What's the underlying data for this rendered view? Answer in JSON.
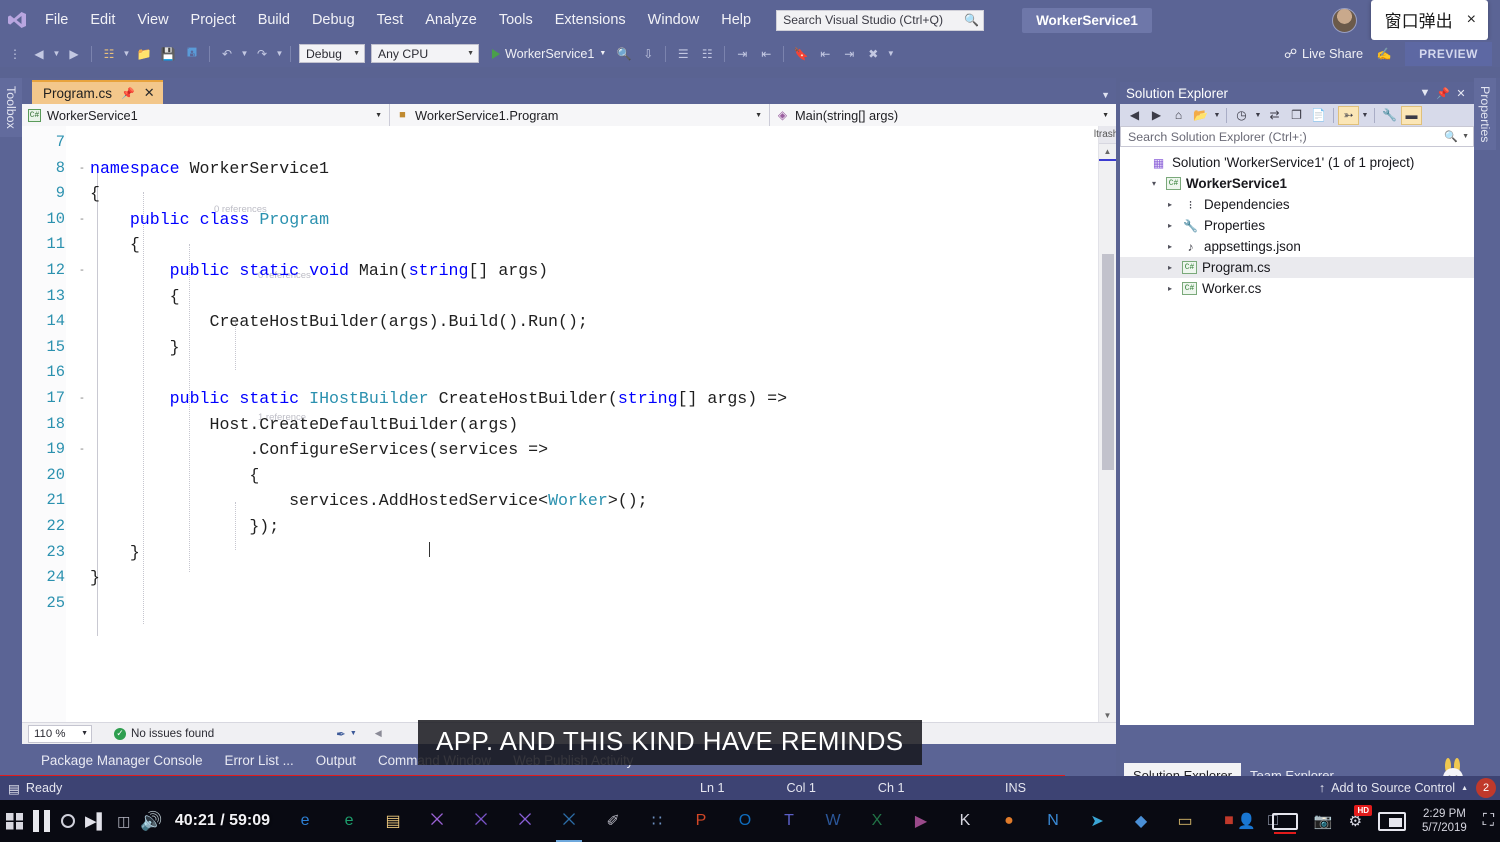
{
  "titlebar": {
    "logo_icon": "visual-studio-logo-icon",
    "menu": [
      "File",
      "Edit",
      "View",
      "Project",
      "Build",
      "Debug",
      "Test",
      "Analyze",
      "Tools",
      "Extensions",
      "Window",
      "Help"
    ],
    "search_placeholder": "Search Visual Studio (Ctrl+Q)",
    "search_icon": "search-icon",
    "solution_name": "WorkerService1",
    "avatar_icon": "user-avatar",
    "popup": {
      "text": "窗口弹出",
      "close": "×"
    }
  },
  "toolbar": {
    "config": "Debug",
    "platform": "Any CPU",
    "run_target": "WorkerService1",
    "live_share": "Live Share",
    "preview_badge": "PREVIEW",
    "icons": [
      "navigate-back-icon",
      "navigate-forward-icon",
      "new-project-icon",
      "open-file-icon",
      "save-icon",
      "save-all-icon",
      "undo-icon",
      "redo-icon",
      "attach-icon",
      "step-icon",
      "comment-icon",
      "uncomment-icon",
      "indent-icon",
      "outdent-icon",
      "bookmark-icon"
    ]
  },
  "docks": {
    "left_tab": "Toolbox",
    "right_tab": "Properties"
  },
  "editor": {
    "tab": {
      "label": "Program.cs",
      "pin_icon": "pin-icon",
      "close_icon": "close-icon"
    },
    "nav": {
      "project": "WorkerService1",
      "type": "WorkerService1.Program",
      "member": "Main(string[] args)"
    },
    "reference_hints": [
      "0 references",
      "0 references",
      "1 reference"
    ],
    "lines": [
      {
        "n": "7",
        "fold": "",
        "text": ""
      },
      {
        "n": "8",
        "fold": "-",
        "text": "namespace WorkerService1",
        "indent": 0
      },
      {
        "n": "9",
        "fold": "",
        "text": "{",
        "indent": 0
      },
      {
        "n": "10",
        "fold": "-",
        "text": "    public class Program",
        "indent": 1
      },
      {
        "n": "11",
        "fold": "",
        "text": "    {",
        "indent": 1
      },
      {
        "n": "12",
        "fold": "-",
        "text": "        public static void Main(string[] args)",
        "indent": 2
      },
      {
        "n": "13",
        "fold": "",
        "text": "        {",
        "indent": 2
      },
      {
        "n": "14",
        "fold": "",
        "text": "            CreateHostBuilder(args).Build().Run();",
        "indent": 3
      },
      {
        "n": "15",
        "fold": "",
        "text": "        }",
        "indent": 2
      },
      {
        "n": "16",
        "fold": "",
        "text": "",
        "indent": 2
      },
      {
        "n": "17",
        "fold": "-",
        "text": "        public static IHostBuilder CreateHostBuilder(string[] args) =>",
        "indent": 2
      },
      {
        "n": "18",
        "fold": "",
        "text": "            Host.CreateDefaultBuilder(args)",
        "indent": 3
      },
      {
        "n": "19",
        "fold": "-",
        "text": "                .ConfigureServices(services =>",
        "indent": 3
      },
      {
        "n": "20",
        "fold": "",
        "text": "                {",
        "indent": 3
      },
      {
        "n": "21",
        "fold": "",
        "text": "                    services.AddHostedService<Worker>();",
        "indent": 4
      },
      {
        "n": "22",
        "fold": "",
        "text": "                });",
        "indent": 3
      },
      {
        "n": "23",
        "fold": "",
        "text": "    }",
        "indent": 1
      },
      {
        "n": "24",
        "fold": "",
        "text": "}",
        "indent": 0
      },
      {
        "n": "25",
        "fold": "",
        "text": ""
      }
    ],
    "status": {
      "zoom": "110 %",
      "issues": "No issues found",
      "issues_icon": "check-circle-icon",
      "brush_icon": "formatting-icon"
    }
  },
  "panel_tabs": [
    "Package Manager Console",
    "Error List ...",
    "Output",
    "Command Window",
    "Web Publish Activity"
  ],
  "solution_explorer": {
    "title": "Solution Explorer",
    "header_icons": [
      "chevron-down-icon",
      "pin-icon",
      "close-icon"
    ],
    "toolbar_icons": [
      "back-icon",
      "forward-icon",
      "home-icon",
      "new-folder-icon",
      "dropdown-icon",
      "pending-changes-icon",
      "sync-icon",
      "collapse-all-icon",
      "properties-icon",
      "show-all-files-icon",
      "dropdown2-icon",
      "wrench-icon",
      "preview-selected-icon"
    ],
    "search_placeholder": "Search Solution Explorer (Ctrl+;)",
    "tree": [
      {
        "label": "Solution 'WorkerService1' (1 of 1 project)",
        "icon": "solution-icon",
        "depth": 0,
        "twisty": "",
        "bold": false,
        "selected": false
      },
      {
        "label": "WorkerService1",
        "icon": "csharp-project-icon",
        "depth": 1,
        "twisty": "▾",
        "bold": true,
        "selected": false
      },
      {
        "label": "Dependencies",
        "icon": "dependencies-icon",
        "depth": 2,
        "twisty": "▸",
        "bold": false,
        "selected": false
      },
      {
        "label": "Properties",
        "icon": "properties-wrench-icon",
        "depth": 2,
        "twisty": "▸",
        "bold": false,
        "selected": false
      },
      {
        "label": "appsettings.json",
        "icon": "json-file-icon",
        "depth": 2,
        "twisty": "▸",
        "bold": false,
        "selected": false
      },
      {
        "label": "Program.cs",
        "icon": "csharp-file-icon",
        "depth": 2,
        "twisty": "▸",
        "bold": false,
        "selected": true
      },
      {
        "label": "Worker.cs",
        "icon": "csharp-file-icon",
        "depth": 2,
        "twisty": "▸",
        "bold": false,
        "selected": false
      }
    ],
    "bottom_tabs": [
      {
        "label": "Solution Explorer",
        "active": true
      },
      {
        "label": "Team Explorer",
        "active": false
      }
    ],
    "mascot_icon": "rabbit-mascot-icon"
  },
  "statusbar": {
    "ready": "Ready",
    "ready_icon": "status-icon",
    "ln": "Ln 1",
    "col": "Col 1",
    "ch": "Ch 1",
    "ins": "INS",
    "source_control": "Add to Source Control",
    "source_control_icon": "upload-arrow-icon",
    "notification_count": "2"
  },
  "media": {
    "subtitle": "APP. AND THIS KIND HAVE REMINDS",
    "current_time": "40:21",
    "total_time": "59:09",
    "time_display": "40:21 / 59:09",
    "pause_icon": "pause-icon",
    "stop_icon": "stop-icon",
    "next_icon": "next-frame-icon",
    "film_icon": "film-strip-icon",
    "volume_icon": "volume-icon"
  },
  "taskbar": {
    "start_icon": "windows-start-icon",
    "apps": [
      {
        "icon": "edge-icon",
        "glyph": "e",
        "color": "#2d7fd3"
      },
      {
        "icon": "edge-legacy-icon",
        "glyph": "e",
        "color": "#1d9e6c"
      },
      {
        "icon": "explorer-icon",
        "glyph": "▤",
        "color": "#e8c47a"
      },
      {
        "icon": "visual-studio-icon",
        "glyph": "⨉",
        "color": "#9b62d6"
      },
      {
        "icon": "visual-studio-2-icon",
        "glyph": "⨉",
        "color": "#7a54c8"
      },
      {
        "icon": "visual-studio-3-icon",
        "glyph": "⨉",
        "color": "#8a5fd8"
      },
      {
        "icon": "vscode-icon",
        "glyph": "⨉",
        "color": "#2d6ea8"
      },
      {
        "icon": "tools-icon",
        "glyph": "✐",
        "color": "#b9b9c4"
      },
      {
        "icon": "store-icon",
        "glyph": "∷",
        "color": "#6c8fbf"
      },
      {
        "icon": "powerpoint-icon",
        "glyph": "P",
        "color": "#d24726"
      },
      {
        "icon": "outlook-icon",
        "glyph": "O",
        "color": "#0f6cbd"
      },
      {
        "icon": "teams-icon",
        "glyph": "T",
        "color": "#5b5fc7"
      },
      {
        "icon": "word-icon",
        "glyph": "W",
        "color": "#2b579a"
      },
      {
        "icon": "excel-icon",
        "glyph": "X",
        "color": "#217346"
      },
      {
        "icon": "media-player-icon",
        "glyph": "▶",
        "color": "#9a4a8a"
      },
      {
        "icon": "kiwi-icon",
        "glyph": "K",
        "color": "#d6d6e0"
      },
      {
        "icon": "firefox-icon",
        "glyph": "●",
        "color": "#e07b2a"
      },
      {
        "icon": "notepad-icon",
        "glyph": "N",
        "color": "#3a8ad6"
      },
      {
        "icon": "telegram-icon",
        "glyph": "➤",
        "color": "#3aa6d6"
      },
      {
        "icon": "azure-icon",
        "glyph": "◆",
        "color": "#4a8fd6"
      },
      {
        "icon": "folder-icon",
        "glyph": "▭",
        "color": "#d6b86a"
      },
      {
        "icon": "sql-icon",
        "glyph": "■",
        "color": "#c0392b"
      },
      {
        "icon": "window-icon",
        "glyph": "□",
        "color": "#9aa0b4"
      }
    ],
    "tray": {
      "people_icon": "people-icon",
      "cc_icon": "closed-captions-icon",
      "camera_icon": "camera-icon",
      "settings_icon": "settings-gear-icon",
      "hd_badge": "HD",
      "pip_icon": "picture-in-picture-icon",
      "time": "2:29 PM",
      "date": "5/7/2019",
      "expand_icon": "fullscreen-icon"
    }
  }
}
